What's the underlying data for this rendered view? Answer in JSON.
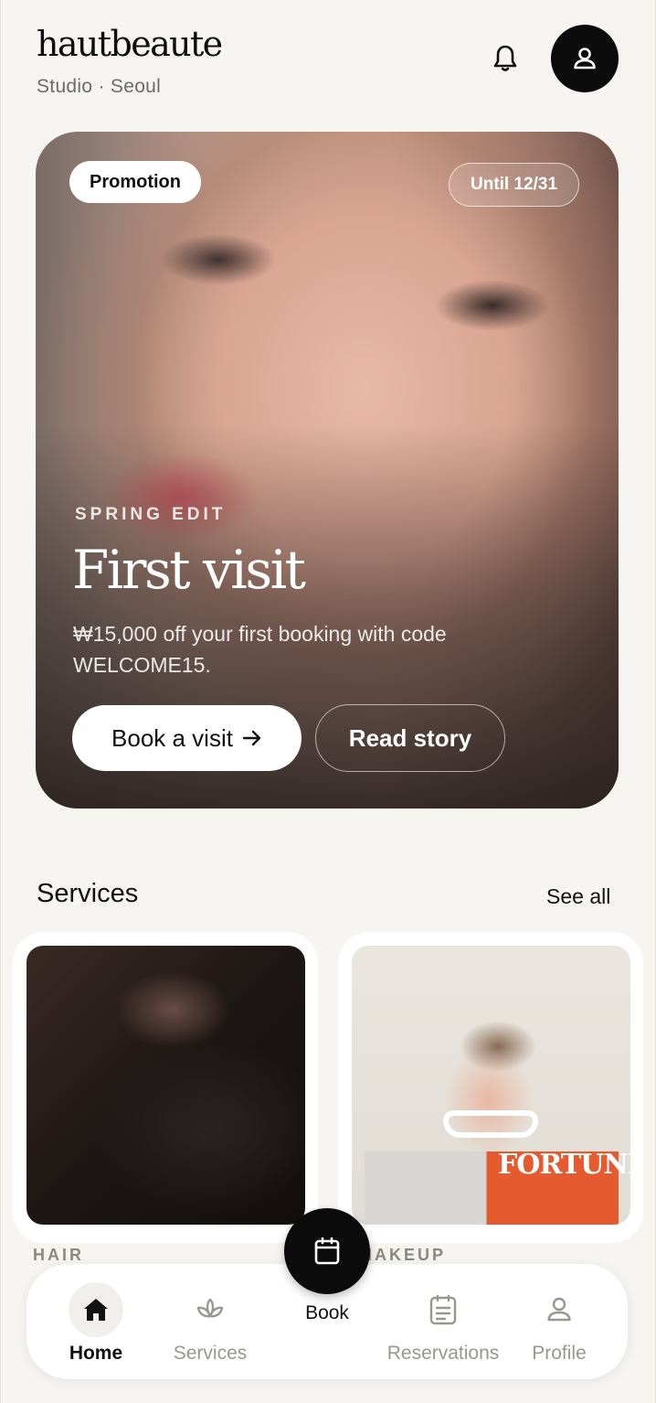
{
  "header": {
    "brand": "hautbeaute",
    "location": "Studio · Seoul",
    "icons": {
      "notifications": "bell-icon",
      "account": "user-icon"
    }
  },
  "promo": {
    "badge": "Promotion",
    "until": "Until 12/31",
    "eyebrow": "SPRING EDIT",
    "title": "First visit",
    "description": "₩15,000 off your first booking with code WELCOME15.",
    "primary_button": "Book a visit",
    "primary_icon": "arrow-right-icon",
    "secondary_button": "Read story"
  },
  "services": {
    "title": "Services",
    "see_all": "See all",
    "items": [
      {
        "label": "HAIR"
      },
      {
        "label": "MAKEUP",
        "magazine_text": "FORTUNE"
      }
    ]
  },
  "nav": {
    "items": [
      {
        "label": "Home",
        "icon": "home-icon",
        "active": true
      },
      {
        "label": "Services",
        "icon": "lotus-icon"
      },
      {
        "label": "Reservations",
        "icon": "list-icon"
      },
      {
        "label": "Profile",
        "icon": "user-icon"
      }
    ],
    "book": {
      "label": "Book",
      "icon": "calendar-icon"
    }
  },
  "colors": {
    "background": "#f6f5f2",
    "primary": "#0b0b0b",
    "muted": "#9a9792"
  }
}
